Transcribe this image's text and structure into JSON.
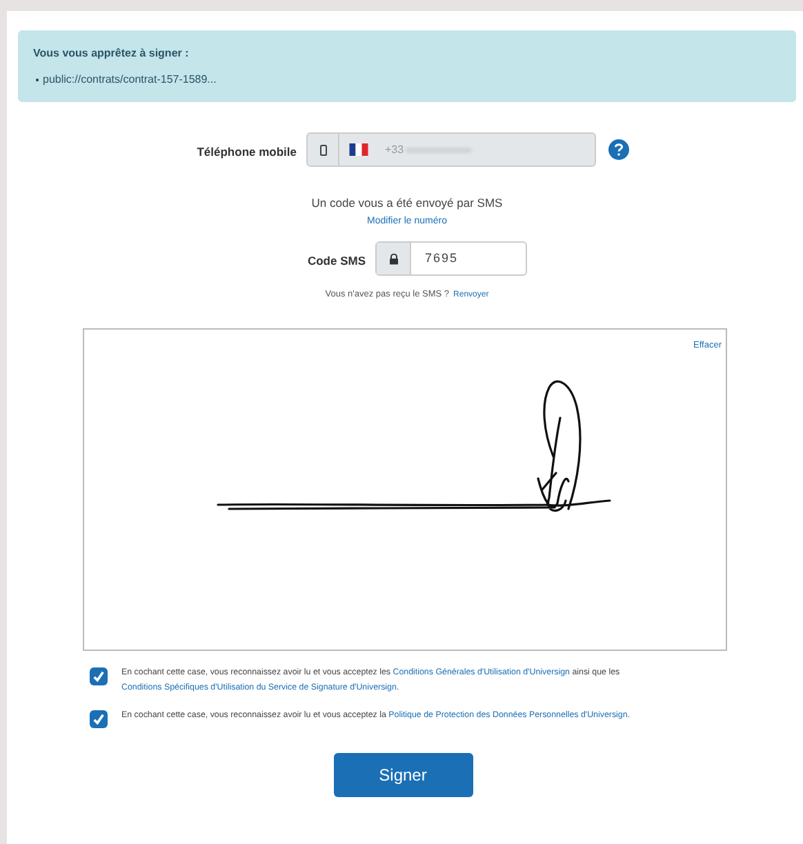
{
  "notice": {
    "title": "Vous vous apprêtez à signer :",
    "items": [
      "public://contrats/contrat-157-1589..."
    ]
  },
  "phone": {
    "label": "Téléphone mobile",
    "prefix": "+33"
  },
  "sms": {
    "message": "Un code vous a été envoyé par SMS",
    "change_link": "Modifier le numéro",
    "code_label": "Code SMS",
    "code_value": "7695",
    "resend_text": "Vous n'avez pas reçu le SMS ?",
    "resend_link": "Renvoyer"
  },
  "signature_pad": {
    "clear_link": "Effacer"
  },
  "consents": [
    {
      "checked": true,
      "parts": [
        {
          "text": "En cochant cette case, vous reconnaissez avoir lu et vous acceptez les ",
          "kind": "text"
        },
        {
          "text": "Conditions Générales d'Utilisation d'Universign",
          "kind": "link"
        },
        {
          "text": " ainsi que les ",
          "kind": "text"
        },
        {
          "text": "Conditions Spécifiques d'Utilisation du Service de Signature d'Universign",
          "kind": "link"
        },
        {
          "text": ".",
          "kind": "text"
        }
      ]
    },
    {
      "checked": true,
      "parts": [
        {
          "text": "En cochant cette case, vous reconnaissez avoir lu et vous acceptez la ",
          "kind": "text"
        },
        {
          "text": "Politique de Protection des Données Personnelles d'Universign",
          "kind": "link"
        },
        {
          "text": ".",
          "kind": "text"
        }
      ]
    }
  ],
  "submit": "Signer"
}
